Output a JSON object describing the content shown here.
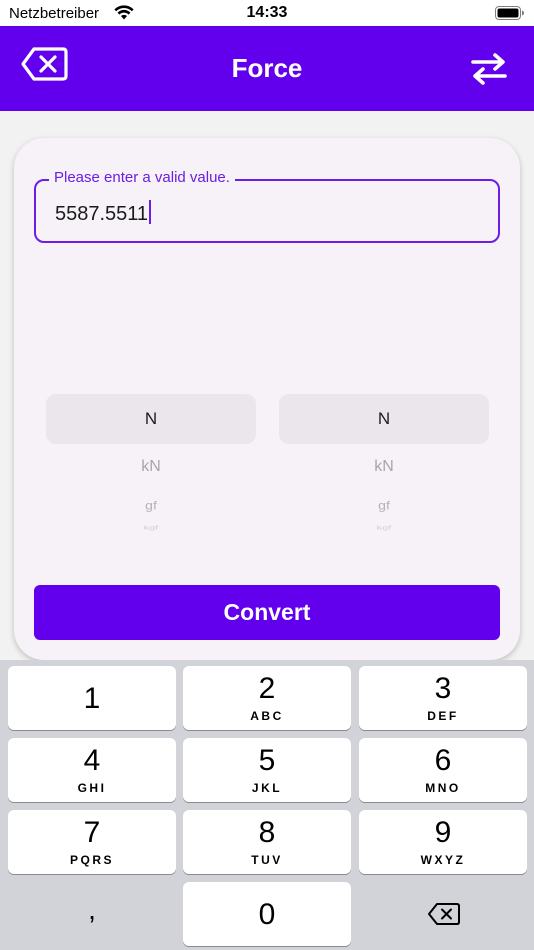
{
  "status_bar": {
    "carrier": "Netzbetreiber",
    "time": "14:33"
  },
  "app_bar": {
    "title": "Force",
    "background": "#6200ee"
  },
  "input": {
    "label": "Please enter a valid value.",
    "value": "5587.5511",
    "accent": "#6a1ee6"
  },
  "picker_from": {
    "items": [
      "N",
      "kN",
      "gf",
      "kgf"
    ],
    "selected": "N"
  },
  "picker_to": {
    "items": [
      "N",
      "kN",
      "gf",
      "kgf"
    ],
    "selected": "N"
  },
  "convert_button": {
    "label": "Convert"
  },
  "keyboard": {
    "keys": [
      {
        "digit": "1",
        "letters": ""
      },
      {
        "digit": "2",
        "letters": "ABC"
      },
      {
        "digit": "3",
        "letters": "DEF"
      },
      {
        "digit": "4",
        "letters": "GHI"
      },
      {
        "digit": "5",
        "letters": "JKL"
      },
      {
        "digit": "6",
        "letters": "MNO"
      },
      {
        "digit": "7",
        "letters": "PQRS"
      },
      {
        "digit": "8",
        "letters": "TUV"
      },
      {
        "digit": "9",
        "letters": "WXYZ"
      },
      {
        "digit": "0",
        "letters": ""
      }
    ],
    "comma": ",",
    "delete_icon": "delete-left-icon"
  }
}
